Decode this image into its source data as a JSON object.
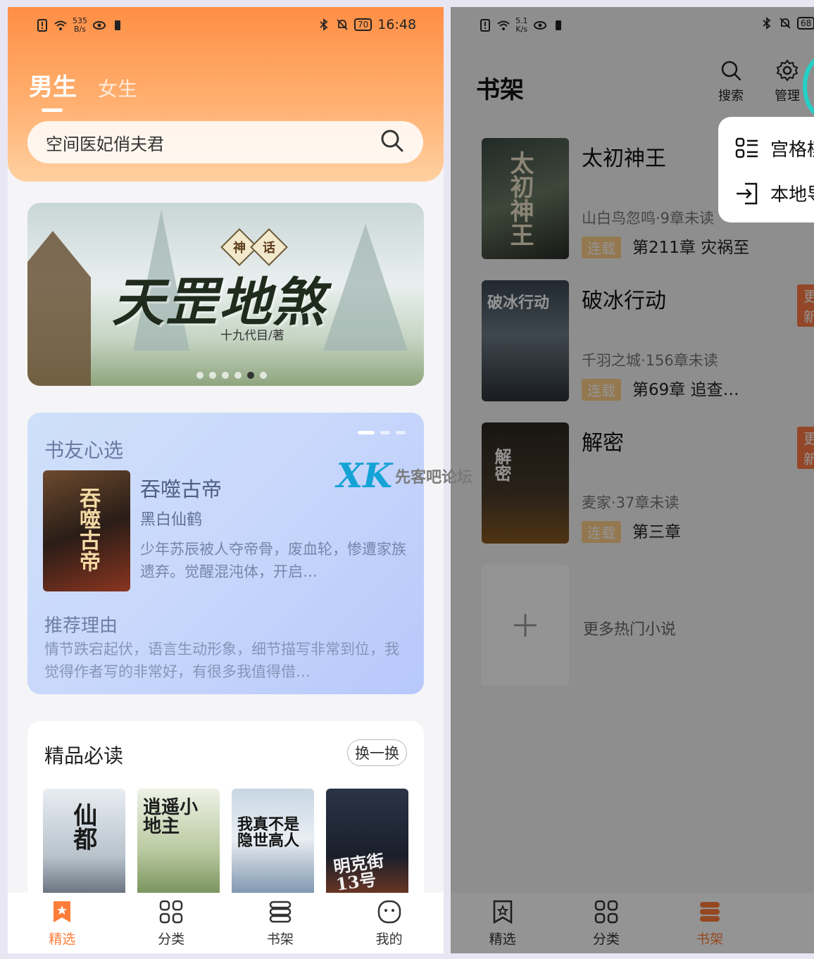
{
  "left": {
    "status": {
      "speed_value": "535",
      "speed_unit": "B/s",
      "battery": "70",
      "time": "16:48"
    },
    "gender_tabs": [
      "男生",
      "女生"
    ],
    "search": {
      "value": "空间医妃俏夫君"
    },
    "banner": {
      "tag_chars": [
        "神",
        "话"
      ],
      "title": "天罡地煞",
      "author": "十九代目/著"
    },
    "rec": {
      "section_title": "书友心选",
      "book_title": "吞噬古帝",
      "author": "黑白仙鹤",
      "description": "少年苏辰被人夺帝骨，废血轮，惨遭家族遗弃。觉醒混沌体，开启…",
      "reason_label": "推荐理由",
      "reason_text": "情节跌宕起伏，语言生动形象，细节描写非常到位，我觉得作者写的非常好，有很多我值得借…",
      "cover_text": "吞噬古帝"
    },
    "must_read": {
      "title": "精品必读",
      "swap_label": "换一换",
      "books": [
        {
          "cover_text": "仙都"
        },
        {
          "cover_text": "逍遥小地主"
        },
        {
          "cover_text": "我真不是隐世高人"
        },
        {
          "cover_text": "明克街13号"
        }
      ]
    },
    "bottom_nav": [
      "精选",
      "分类",
      "书架",
      "我的"
    ],
    "active_tab": "精选"
  },
  "right": {
    "status": {
      "speed_value": "5.1",
      "speed_unit": "K/s",
      "battery": "68"
    },
    "header": {
      "title": "书架",
      "search_label": "搜索",
      "manage_label": "管理"
    },
    "popup": [
      "宫格模式",
      "本地导入"
    ],
    "shelf": [
      {
        "title": "太初神王",
        "meta": "山白鸟忽鸣·9章未读",
        "tag": "连载",
        "chapter": "第211章 灾祸至",
        "update": "",
        "cover_text": "太初神王"
      },
      {
        "title": "破冰行动",
        "meta": "千羽之城·156章未读",
        "tag": "连载",
        "chapter": "第69章 追查…",
        "update": "更新",
        "cover_text": "破冰行动"
      },
      {
        "title": "解密",
        "meta": "麦家·37章未读",
        "tag": "连载",
        "chapter": "第三章",
        "update": "更新",
        "cover_text": "解密"
      }
    ],
    "more_label": "更多热门小说",
    "bottom_nav": [
      "精选",
      "分类",
      "书架"
    ],
    "active_tab": "书架"
  },
  "watermark": {
    "mark": "XK",
    "text": "先客吧论坛"
  },
  "colors": {
    "accent": "#ff7d3a",
    "header_top": "#ff8e45",
    "rec_card": "#c9d8fb",
    "update_badge": "#ff7a45",
    "serial_tag": "#ffcf8a"
  }
}
